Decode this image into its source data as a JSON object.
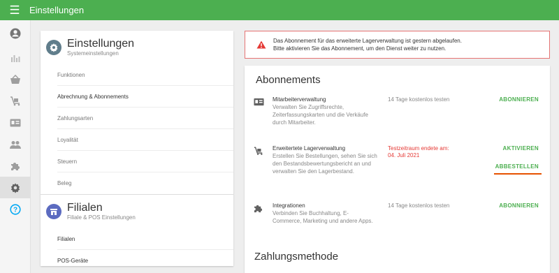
{
  "header": {
    "title": "Einstellungen",
    "menu_icon": "hamburger-icon"
  },
  "nav": {
    "items": [
      {
        "icon": "account-icon"
      },
      {
        "icon": "bar-chart-icon"
      },
      {
        "icon": "basket-icon"
      },
      {
        "icon": "cart-icon"
      },
      {
        "icon": "id-card-icon"
      },
      {
        "icon": "people-icon"
      },
      {
        "icon": "puzzle-icon"
      },
      {
        "icon": "gear-icon"
      },
      {
        "icon": "help-icon"
      }
    ],
    "active_index": 7
  },
  "settings": {
    "title": "Einstellungen",
    "subtitle": "Systemeinstellungen",
    "items": [
      "Funktionen",
      "Abrechnung & Abonnements",
      "Zahlungsarten",
      "Loyalität",
      "Steuern",
      "Beleg"
    ],
    "selected_index": 1
  },
  "branches": {
    "title": "Filialen",
    "subtitle": "Filiale & POS Einstellungen",
    "items": [
      "Filialen",
      "POS-Geräte"
    ]
  },
  "alert": {
    "line1": "Das Abonnement für das erweiterte Lagerverwaltung ist gestern abgelaufen.",
    "line2": "Bitte aktivieren Sie das Abonnement, um den Dienst weiter zu nutzen."
  },
  "subscriptions": {
    "title": "Abonnements",
    "rows": [
      {
        "icon": "id-card-icon",
        "name": "Mitarbeiterverwaltung",
        "description": "Verwalten Sie Zugriffsrechte, Zeiterfassungskarten und die Verkäufe durch Mitarbeiter.",
        "status": "14 Tage kostenlos testen",
        "action": "ABONNIEREN"
      },
      {
        "icon": "cart-icon",
        "name": "Erweitertete Lagerverwaltung",
        "description": "Erstellen Sie Bestellungen, sehen Sie sich den Bestandsbewertungsbericht an und verwalten Sie den Lagerbestand.",
        "status_line1": "Testzeitraum endete am:",
        "status_line2": "04. Juli 2021",
        "action": "AKTIVIEREN",
        "action2": "ABBESTELLEN"
      },
      {
        "icon": "puzzle-icon",
        "name": "Integrationen",
        "description": "Verbinden Sie Buchhaltung, E-Commerce, Marketing und andere Apps.",
        "status": "14 Tage kostenlos testen",
        "action": "ABONNIEREN"
      }
    ]
  },
  "payment": {
    "title": "Zahlungsmethode"
  },
  "colors": {
    "primary": "#4caf50",
    "alert_border": "#e57373",
    "alert_icon": "#e53935",
    "expired_text": "#e53935",
    "highlight_underline": "#e65100",
    "settings_icon_bg": "#607d8b",
    "branches_icon_bg": "#5c6bc0",
    "help_icon": "#03a9f4"
  }
}
